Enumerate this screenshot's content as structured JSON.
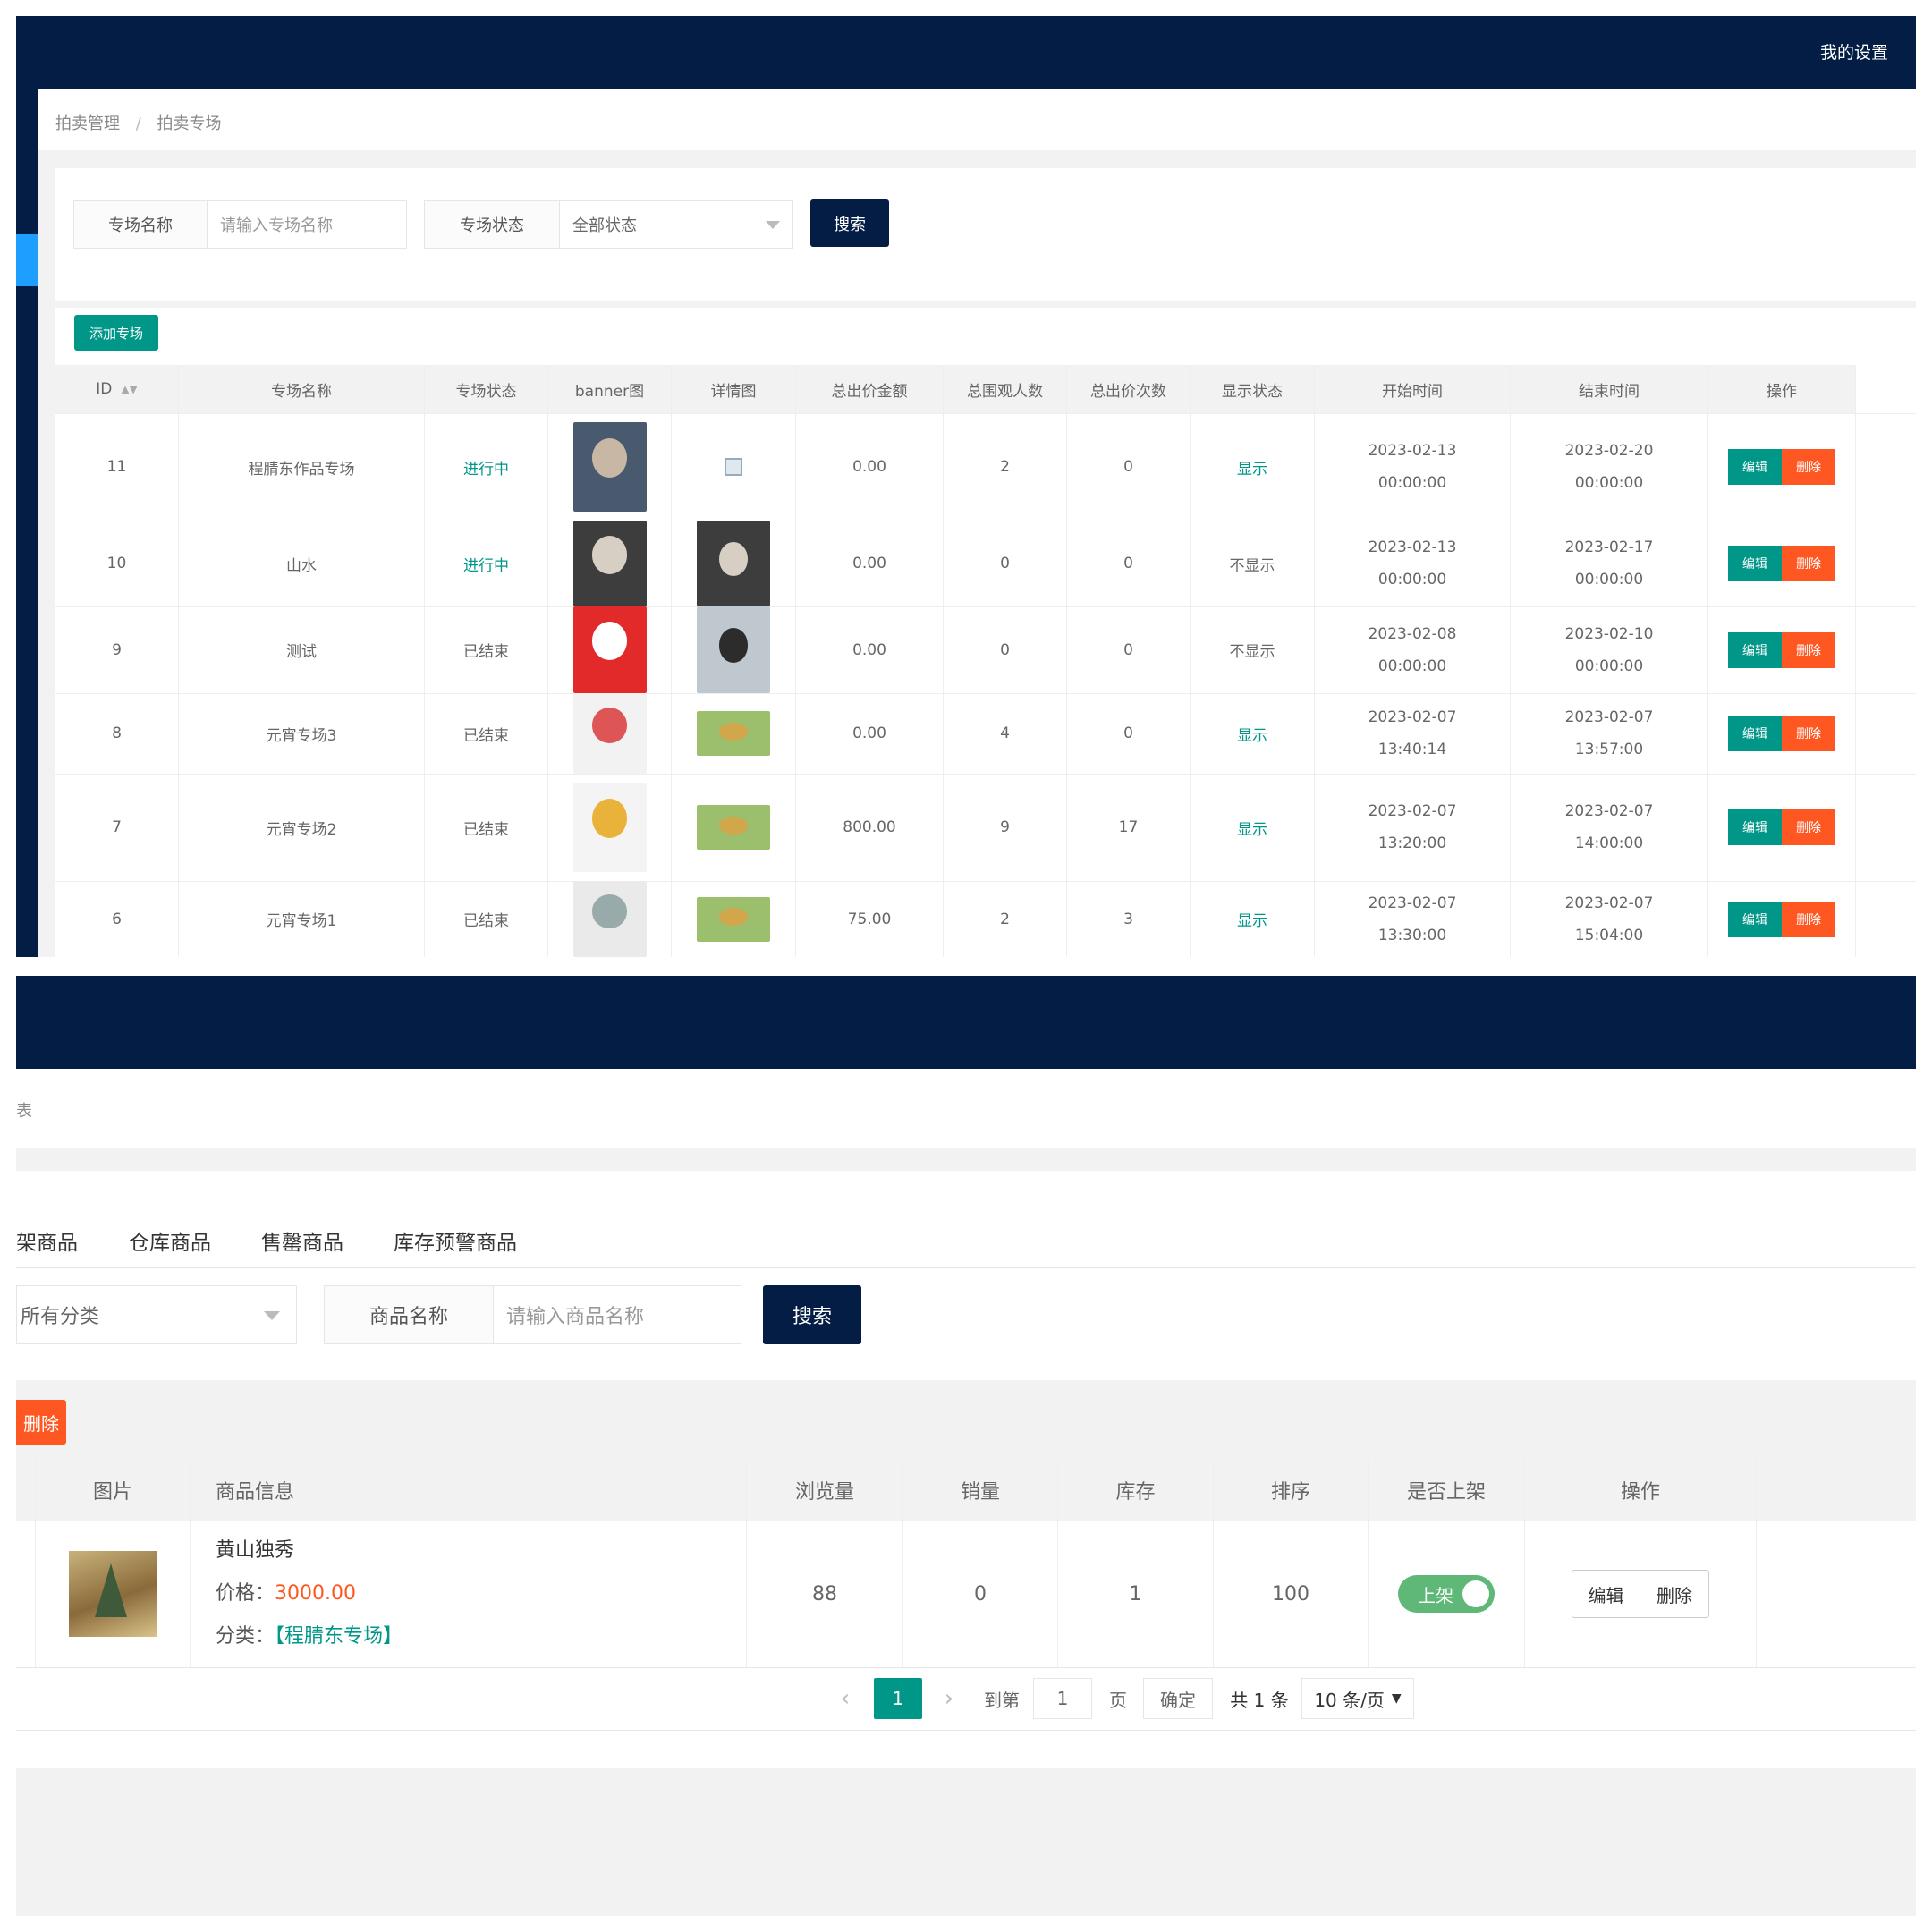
{
  "topbar": {
    "settings_label": "我的设置"
  },
  "breadcrumb": {
    "item1": "拍卖管理",
    "sep": "/",
    "item2": "拍卖专场"
  },
  "search1": {
    "name_label": "专场名称",
    "name_placeholder": "请输入专场名称",
    "status_label": "专场状态",
    "status_value": "全部状态",
    "search_label": "搜索"
  },
  "add_button": "添加专场",
  "table1": {
    "headers": [
      "ID",
      "专场名称",
      "专场状态",
      "banner图",
      "详情图",
      "总出价金额",
      "总围观人数",
      "总出价次数",
      "显示状态",
      "开始时间",
      "结束时间",
      "操作"
    ],
    "edit_label": "编辑",
    "delete_label": "删除",
    "rows": [
      {
        "id": "11",
        "name": "程腈东作品专场",
        "status": "进行中",
        "amount": "0.00",
        "viewers": "2",
        "bids": "0",
        "display": "显示",
        "start_date": "2023-02-13",
        "start_time": "00:00:00",
        "end_date": "2023-02-20",
        "end_time": "00:00:00"
      },
      {
        "id": "10",
        "name": "山水",
        "status": "进行中",
        "amount": "0.00",
        "viewers": "0",
        "bids": "0",
        "display": "不显示",
        "start_date": "2023-02-13",
        "start_time": "00:00:00",
        "end_date": "2023-02-17",
        "end_time": "00:00:00"
      },
      {
        "id": "9",
        "name": "测试",
        "status": "已结束",
        "amount": "0.00",
        "viewers": "0",
        "bids": "0",
        "display": "不显示",
        "start_date": "2023-02-08",
        "start_time": "00:00:00",
        "end_date": "2023-02-10",
        "end_time": "00:00:00"
      },
      {
        "id": "8",
        "name": "元宵专场3",
        "status": "已结束",
        "amount": "0.00",
        "viewers": "4",
        "bids": "0",
        "display": "显示",
        "start_date": "2023-02-07",
        "start_time": "13:40:14",
        "end_date": "2023-02-07",
        "end_time": "13:57:00"
      },
      {
        "id": "7",
        "name": "元宵专场2",
        "status": "已结束",
        "amount": "800.00",
        "viewers": "9",
        "bids": "17",
        "display": "显示",
        "start_date": "2023-02-07",
        "start_time": "13:20:00",
        "end_date": "2023-02-07",
        "end_time": "14:00:00"
      },
      {
        "id": "6",
        "name": "元宵专场1",
        "status": "已结束",
        "amount": "75.00",
        "viewers": "2",
        "bids": "3",
        "display": "显示",
        "start_date": "2023-02-07",
        "start_time": "13:30:00",
        "end_date": "2023-02-07",
        "end_time": "15:04:00"
      }
    ]
  },
  "lower": {
    "breadcrumb_fragment": "表",
    "tabs": [
      "架商品",
      "仓库商品",
      "售罄商品",
      "库存预警商品"
    ],
    "category_value": "所有分类",
    "goods_label": "商品名称",
    "goods_placeholder": "请输入商品名称",
    "search_label": "搜索",
    "delete_label": "删除",
    "headers": [
      "图片",
      "商品信息",
      "浏览量",
      "销量",
      "库存",
      "排序",
      "是否上架",
      "操作"
    ],
    "row": {
      "title": "黄山独秀",
      "price_label": "价格：",
      "price": "3000.00",
      "category_label": "分类：",
      "category": "【程腈东专场】",
      "views": "88",
      "sales": "0",
      "stock": "1",
      "sort": "100",
      "toggle_label": "上架",
      "edit_label": "编辑",
      "delete_label": "删除"
    },
    "pagination": {
      "current": "1",
      "goto_label": "到第",
      "page_input": "1",
      "page_unit": "页",
      "confirm": "确定",
      "total": "共 1 条",
      "per_page": "10 条/页"
    }
  },
  "colors": {
    "navy": "#031d44",
    "green": "#009688",
    "orange": "#ff5722",
    "price": "#ff5722"
  }
}
